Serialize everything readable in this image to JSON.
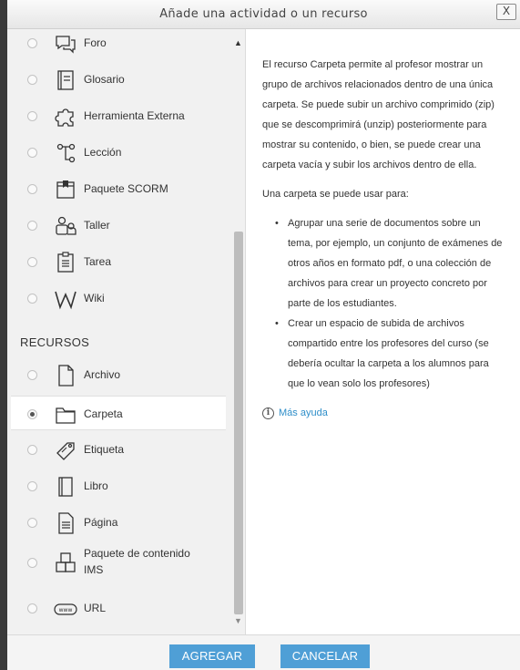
{
  "dialog": {
    "title": "Añade una actividad o un recurso",
    "close_label": "X"
  },
  "activities": [
    {
      "label": "Foro",
      "icon": "forum-icon"
    },
    {
      "label": "Glosario",
      "icon": "glossary-icon"
    },
    {
      "label": "Herramienta Externa",
      "icon": "puzzle-icon"
    },
    {
      "label": "Lección",
      "icon": "lesson-icon"
    },
    {
      "label": "Paquete SCORM",
      "icon": "scorm-package-icon"
    },
    {
      "label": "Taller",
      "icon": "workshop-icon"
    },
    {
      "label": "Tarea",
      "icon": "assignment-icon"
    },
    {
      "label": "Wiki",
      "icon": "wiki-icon"
    }
  ],
  "resources_heading": "RECURSOS",
  "resources": [
    {
      "label": "Archivo",
      "icon": "file-icon"
    },
    {
      "label": "Carpeta",
      "icon": "folder-icon",
      "selected": true
    },
    {
      "label": "Etiqueta",
      "icon": "label-tag-icon"
    },
    {
      "label": "Libro",
      "icon": "book-icon"
    },
    {
      "label": "Página",
      "icon": "page-icon"
    },
    {
      "label": "Paquete de contenido IMS",
      "icon": "ims-package-icon"
    },
    {
      "label": "URL",
      "icon": "url-icon"
    }
  ],
  "help": {
    "intro": "El recurso Carpeta permite al profesor mostrar un grupo de archivos relacionados dentro de una única carpeta. Se puede subir un archivo comprimido (zip) que se descomprimirá (unzip) posteriormente para mostrar su contenido, o bien, se puede crear una carpeta vacía y subir los archivos dentro de ella.",
    "uses_heading": "Una carpeta se puede usar para:",
    "uses": [
      "Agrupar una serie de documentos sobre un tema, por ejemplo, un conjunto de exámenes de otros años en formato pdf, o una colección de archivos para crear un proyecto concreto por parte de los estudiantes.",
      "Crear un espacio de subida de archivos compartido entre los profesores del curso (se debería ocultar la carpeta a los alumnos para que lo vean solo los profesores)"
    ],
    "more_help": "Más ayuda"
  },
  "buttons": {
    "add": "AGREGAR",
    "cancel": "CANCELAR"
  },
  "colors": {
    "button": "#4f9fd6",
    "link": "#2e8ec9",
    "pane": "#f1f1f1"
  }
}
